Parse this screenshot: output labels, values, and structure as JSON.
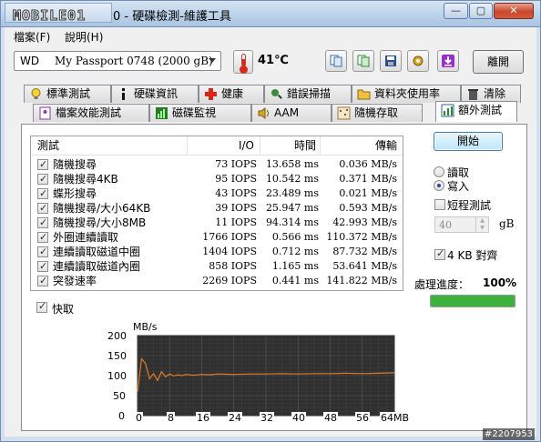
{
  "window": {
    "logo_text": "MOBILE01",
    "title": "0 - 硬碟檢測-維護工具",
    "btn_min": "—",
    "btn_max": "▢",
    "btn_close": "✕"
  },
  "menu": {
    "file": "檔案(F)",
    "help": "說明(H)"
  },
  "toolbar": {
    "drive_brand": "WD",
    "drive_model": "My Passport 0748 (2000 gB)",
    "temperature": "41℃",
    "exit_label": "離開",
    "icons": [
      "copy-icon",
      "copy-green-icon",
      "save-icon",
      "settings-icon",
      "download-icon"
    ]
  },
  "tabs_row1": [
    {
      "label": "標準測試",
      "icon": "lightbulb-icon"
    },
    {
      "label": "硬碟資訊",
      "icon": "info-icon"
    },
    {
      "label": "健康",
      "icon": "health-cross-icon"
    },
    {
      "label": "錯誤掃描",
      "icon": "scan-icon"
    },
    {
      "label": "資料夾使用率",
      "icon": "folder-icon"
    },
    {
      "label": "清除",
      "icon": "trash-icon"
    }
  ],
  "tabs_row2": [
    {
      "label": "檔案效能測試",
      "icon": "file-perf-icon"
    },
    {
      "label": "磁碟監視",
      "icon": "monitor-chart-icon"
    },
    {
      "label": "AAM",
      "icon": "speaker-icon"
    },
    {
      "label": "隨機存取",
      "icon": "random-access-icon"
    },
    {
      "label": "額外測試",
      "icon": "extra-test-icon"
    }
  ],
  "results": {
    "headers": [
      "測試",
      "I/O",
      "時間",
      "傳輸"
    ],
    "rows": [
      {
        "name": "隨機搜尋",
        "io": "73 IOPS",
        "time": "13.658 ms",
        "transfer": "0.036 MB/s"
      },
      {
        "name": "隨機搜尋4KB",
        "io": "95 IOPS",
        "time": "10.542 ms",
        "transfer": "0.371 MB/s"
      },
      {
        "name": "蝶形搜尋",
        "io": "43 IOPS",
        "time": "23.489 ms",
        "transfer": "0.021 MB/s"
      },
      {
        "name": "隨機搜尋/大小64KB",
        "io": "39 IOPS",
        "time": "25.947 ms",
        "transfer": "0.593 MB/s"
      },
      {
        "name": "隨機搜尋/大小8MB",
        "io": "11 IOPS",
        "time": "94.314 ms",
        "transfer": "42.993 MB/s"
      },
      {
        "name": "外圈連續讀取",
        "io": "1766 IOPS",
        "time": "0.566 ms",
        "transfer": "110.372 MB/s"
      },
      {
        "name": "連續讀取磁道中圈",
        "io": "1404 IOPS",
        "time": "0.712 ms",
        "transfer": "87.732 MB/s"
      },
      {
        "name": "連續讀取磁道內圈",
        "io": "858 IOPS",
        "time": "1.165 ms",
        "transfer": "53.641 MB/s"
      },
      {
        "name": "突發速率",
        "io": "2269 IOPS",
        "time": "0.441 ms",
        "transfer": "141.822 MB/s"
      }
    ]
  },
  "quick_label": "快取",
  "side": {
    "start_label": "開始",
    "read_label": "讀取",
    "write_label": "寫入",
    "write_selected": true,
    "short_test_label": "短程測試",
    "short_test_value": "40",
    "gb_label": "gB",
    "align_label": "4 KB 對齊",
    "progress_label": "處理進度：",
    "progress_text": "100%",
    "progress_fraction": 1.0,
    "progress_color": "#3cb33c"
  },
  "chart_data": {
    "type": "line",
    "ylabel": "MB/s",
    "xticks": [
      "0",
      "8",
      "16",
      "24",
      "32",
      "40",
      "48",
      "56",
      "64MB"
    ],
    "yticks": [
      "200",
      "150",
      "100",
      "50",
      "0"
    ],
    "ylim": [
      0,
      200
    ],
    "xlim": [
      0,
      64
    ],
    "grid": true,
    "background": "#303030",
    "line_color": "#e07a2a",
    "series": [
      {
        "x": [
          0,
          1,
          2,
          3,
          4,
          5,
          6,
          7,
          8,
          9,
          10,
          11,
          12,
          14,
          16,
          18,
          20,
          24,
          28,
          32,
          36,
          40,
          44,
          48,
          52,
          56,
          60,
          64
        ],
        "values": [
          60,
          142,
          130,
          92,
          105,
          88,
          110,
          97,
          104,
          99,
          102,
          100,
          103,
          101,
          103,
          102,
          104,
          103,
          104,
          104,
          105,
          104,
          105,
          105,
          106,
          105,
          106,
          107
        ]
      }
    ]
  },
  "watermark": "#2207953"
}
